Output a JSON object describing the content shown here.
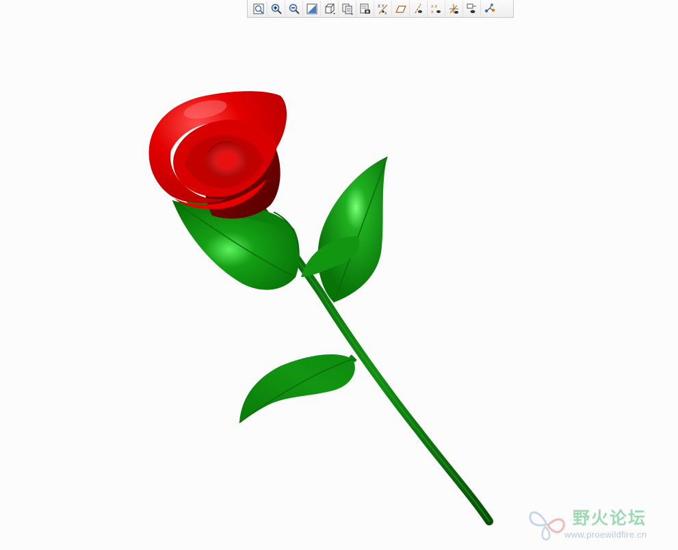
{
  "toolbar": {
    "tools": [
      {
        "name": "refit-icon",
        "title": "Refit"
      },
      {
        "name": "zoom-in-icon",
        "title": "Zoom In"
      },
      {
        "name": "zoom-out-icon",
        "title": "Zoom Out"
      },
      {
        "name": "repaint-icon",
        "title": "Repaint"
      },
      {
        "name": "display-style-icon",
        "title": "Display Style"
      },
      {
        "name": "saved-orientations-icon",
        "title": "Saved Orientations"
      },
      {
        "name": "view-manager-icon",
        "title": "View Manager"
      },
      {
        "name": "datum-display-icon",
        "title": "Datum Display Filters"
      },
      {
        "name": "plane-display-icon",
        "title": "Plane Display"
      },
      {
        "name": "axis-display-icon",
        "title": "Axis Display"
      },
      {
        "name": "point-display-icon",
        "title": "Point Display"
      },
      {
        "name": "csys-display-icon",
        "title": "Csys Display"
      },
      {
        "name": "annotation-display-icon",
        "title": "Annotation Display"
      },
      {
        "name": "spin-center-icon",
        "title": "Spin Center"
      }
    ]
  },
  "colors": {
    "petal": "#e00000",
    "petal_dark": "#6a0000",
    "leaf": "#0b8a0b",
    "stem": "#0a6d0a",
    "watermark_text": "#8fd2a8",
    "watermark_url": "#b9c9dd"
  },
  "watermark": {
    "title": "野火论坛",
    "url": "www.proewildfire.cn"
  }
}
